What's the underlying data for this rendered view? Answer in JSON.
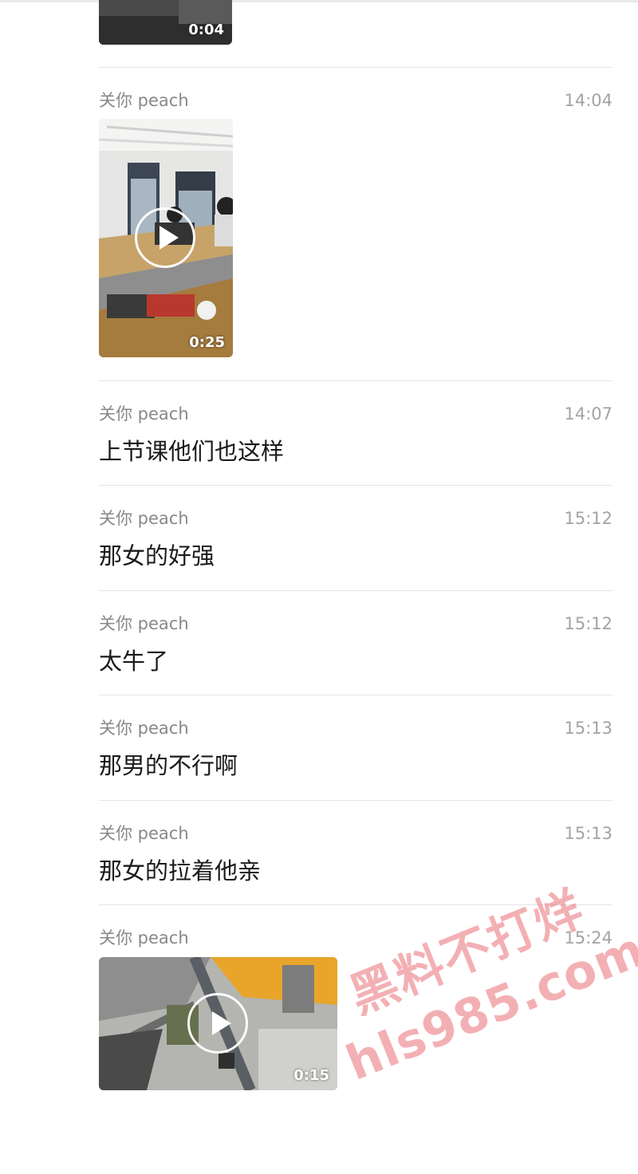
{
  "chat": {
    "messages": [
      {
        "type": "video",
        "duration": "0:04"
      },
      {
        "type": "video",
        "sender": "关你 peach",
        "time": "14:04",
        "duration": "0:25"
      },
      {
        "type": "text",
        "sender": "关你 peach",
        "time": "14:07",
        "text": "上节课他们也这样"
      },
      {
        "type": "text",
        "sender": "关你 peach",
        "time": "15:12",
        "text": "那女的好强"
      },
      {
        "type": "text",
        "sender": "关你 peach",
        "time": "15:12",
        "text": "太牛了"
      },
      {
        "type": "text",
        "sender": "关你 peach",
        "time": "15:13",
        "text": "那男的不行啊"
      },
      {
        "type": "text",
        "sender": "关你 peach",
        "time": "15:13",
        "text": "那女的拉着他亲"
      },
      {
        "type": "video",
        "sender": "关你 peach",
        "time": "15:24",
        "duration": "0:15"
      }
    ]
  },
  "watermark": {
    "line1": "黑料不打烊",
    "line2": "hls985.com"
  },
  "icons": {
    "play": "play-icon"
  },
  "colors": {
    "sender": "#888888",
    "time": "#a3a3a3",
    "message": "#1a1a1a",
    "divider": "#e4e4e4",
    "watermark": "#e97076"
  }
}
